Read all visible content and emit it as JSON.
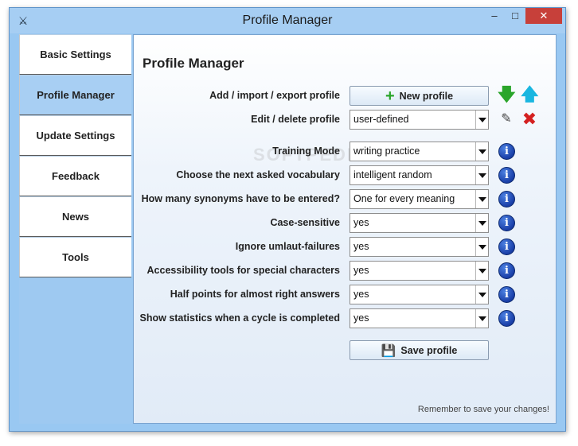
{
  "window": {
    "title": "Profile Manager",
    "app_icon_glyph": "⚔",
    "controls": {
      "minimize": "–",
      "maximize": "□",
      "close": "✕"
    }
  },
  "sidebar": {
    "items": [
      {
        "label": "Basic Settings",
        "active": false
      },
      {
        "label": "Profile Manager",
        "active": true
      },
      {
        "label": "Update Settings",
        "active": false
      },
      {
        "label": "Feedback",
        "active": false
      },
      {
        "label": "News",
        "active": false
      },
      {
        "label": "Tools",
        "active": false
      }
    ]
  },
  "main": {
    "heading": "Profile Manager",
    "watermark": "SOFTPEDIA",
    "profile": {
      "add_label": "Add / import / export profile",
      "new_profile_button": "New profile",
      "edit_label": "Edit / delete profile",
      "selected_profile": "user-defined",
      "icons": [
        "arrow-down-icon",
        "arrow-up-icon",
        "edit-icon",
        "delete-icon"
      ]
    },
    "settings": [
      {
        "label": "Training Mode",
        "value": "writing practice"
      },
      {
        "label": "Choose the next asked vocabulary",
        "value": "intelligent random"
      },
      {
        "label": "How many synonyms have to be entered?",
        "value": "One for every meaning"
      },
      {
        "label": "Case-sensitive",
        "value": "yes"
      },
      {
        "label": "Ignore umlaut-failures",
        "value": "yes"
      },
      {
        "label": "Accessibility tools for special characters",
        "value": "yes"
      },
      {
        "label": "Half points for almost right answers",
        "value": "yes"
      },
      {
        "label": "Show statistics when a cycle is completed",
        "value": "yes"
      }
    ],
    "info_glyph": "i",
    "save_button": "Save profile",
    "footer_note": "Remember to save your changes!"
  },
  "colors": {
    "window_bg": "#99c8f2",
    "active_tab": "#a8cff3",
    "close_button": "#c7403a",
    "info_icon": "#1a3fa8",
    "green_arrow": "#2aa52a",
    "cyan_arrow": "#19b6e0",
    "red_x": "#d42020"
  }
}
